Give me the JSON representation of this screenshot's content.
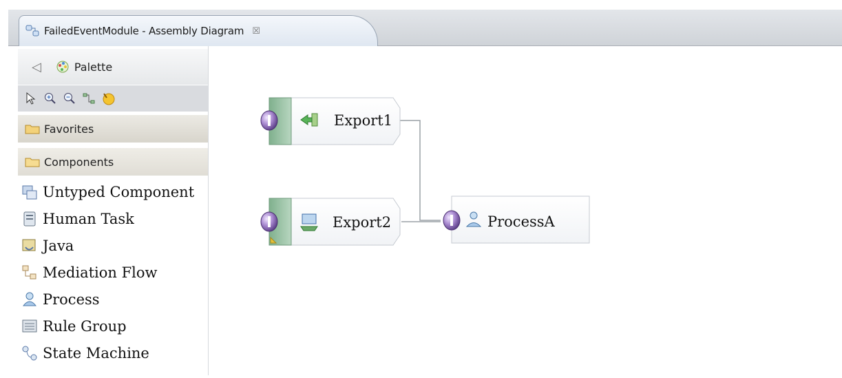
{
  "editor_tab": {
    "title": "FailedEventModule - Assembly Diagram",
    "close_glyph": "☒"
  },
  "palette": {
    "title": "Palette",
    "collapse_glyph": "◁",
    "tools": [
      "select-tool",
      "zoom-in-tool",
      "zoom-out-tool",
      "wire-tool",
      "note-tool"
    ],
    "drawers": {
      "favorites": "Favorites",
      "components": "Components"
    },
    "items": [
      {
        "label": "Untyped Component",
        "icon": "untyped-component-icon"
      },
      {
        "label": "Human Task",
        "icon": "human-task-icon"
      },
      {
        "label": "Java",
        "icon": "java-icon"
      },
      {
        "label": "Mediation Flow",
        "icon": "mediation-flow-icon"
      },
      {
        "label": "Process",
        "icon": "process-icon"
      },
      {
        "label": "Rule Group",
        "icon": "rule-group-icon"
      },
      {
        "label": "State Machine",
        "icon": "state-machine-icon"
      }
    ]
  },
  "diagram": {
    "exports": [
      {
        "label": "Export1",
        "icon": "export-icon"
      },
      {
        "label": "Export2",
        "icon": "web-service-export-icon"
      }
    ],
    "component": {
      "label": "ProcessA",
      "icon": "process-icon"
    }
  }
}
